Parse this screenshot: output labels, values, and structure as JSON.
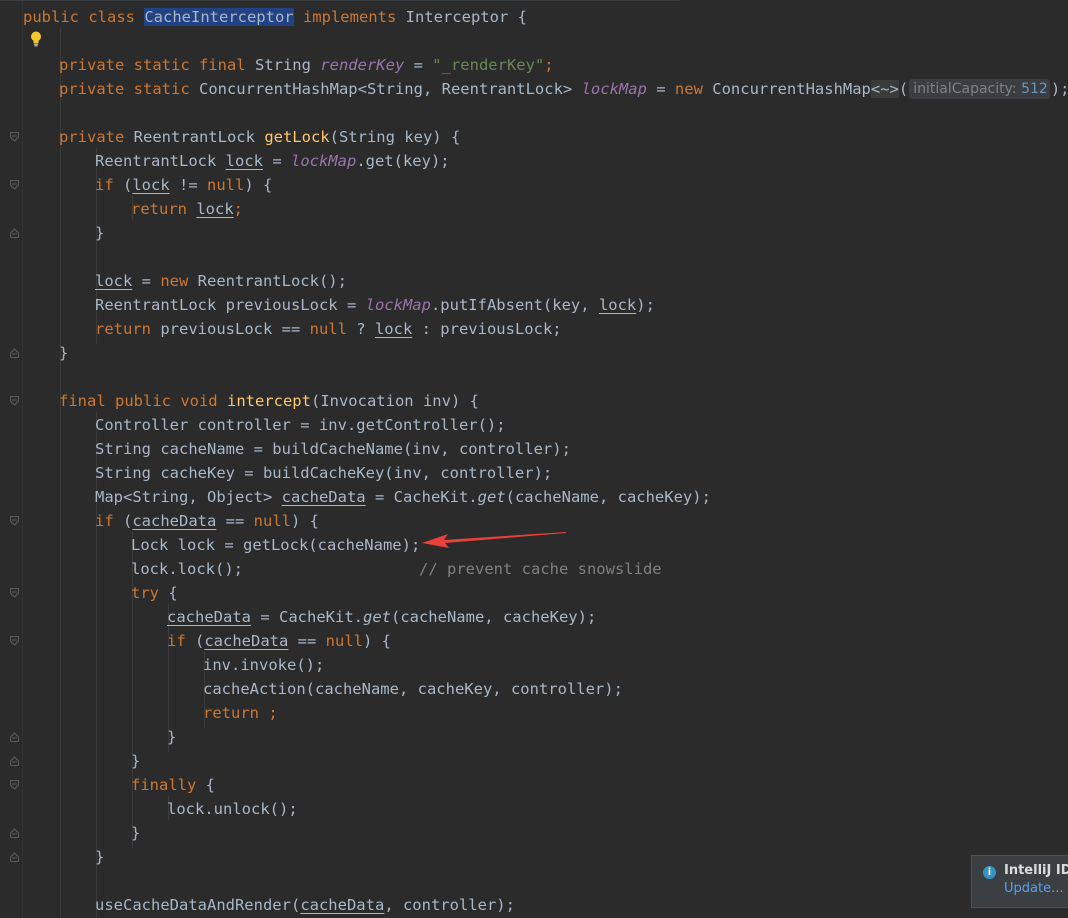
{
  "editor": {
    "language": "java",
    "class_name": "CacheInterceptor",
    "caret_line": 1,
    "highlighted_identifier": "CacheInterceptor",
    "colors": {
      "background": "#2b2b2b",
      "keyword": "#cc7832",
      "method_declaration": "#ffc66d",
      "string": "#6a8759",
      "number": "#6897bb",
      "static_field": "#9876aa",
      "comment": "#808080",
      "default_text": "#a9b7c6"
    },
    "inlay_hint": {
      "name": "initialCapacity:",
      "value": "512"
    },
    "lines": {
      "l1": {
        "kw1": "public class ",
        "cls": "CacheInterceptor",
        "kw2": " implements ",
        "rest": "Interceptor {"
      },
      "l3": {
        "kw": "private static final ",
        "type": "String ",
        "field": "renderKey",
        "eq": " = ",
        "str": "\"_renderKey\"",
        "semi": ";"
      },
      "l4": {
        "kw": "private static ",
        "type": "ConcurrentHashMap<String, ReentrantLock> ",
        "field": "lockMap",
        "eq": " = ",
        "kw2": "new ",
        "ctor": "ConcurrentHashMap",
        "diamond": "<~>",
        "paren_open": "(",
        "paren_close": ");"
      },
      "l6": {
        "kw": "private ",
        "type": "ReentrantLock ",
        "fn": "getLock",
        "rest": "(String key) {"
      },
      "l7": {
        "type": "ReentrantLock ",
        "var": "lock",
        "eq": " = ",
        "field": "lockMap",
        "rest": ".get(key);"
      },
      "l8": {
        "kw": "if ",
        "p1": "(",
        "var": "lock",
        "op": " != ",
        "kw2": "null",
        "rest": ") {"
      },
      "l9": {
        "kw": "return ",
        "var": "lock",
        "semi": ";"
      },
      "l10": {
        "rest": "}"
      },
      "l12": {
        "var": "lock",
        "eq": " = ",
        "kw": "new ",
        "rest": "ReentrantLock();"
      },
      "l13": {
        "type": "ReentrantLock previousLock = ",
        "field": "lockMap",
        "mid": ".putIfAbsent(key, ",
        "var": "lock",
        "rest": ");"
      },
      "l14": {
        "kw": "return ",
        "mid": "previousLock == ",
        "kw2": "null",
        "q": " ? ",
        "var": "lock",
        "rest": " : previousLock;"
      },
      "l15": {
        "rest": "}"
      },
      "l17": {
        "kw": "final public void ",
        "fn": "intercept",
        "rest": "(Invocation inv) {"
      },
      "l18": {
        "rest": "Controller controller = inv.getController();"
      },
      "l19": {
        "rest": "String cacheName = buildCacheName(inv, controller);"
      },
      "l20": {
        "rest": "String cacheKey = buildCacheKey(inv, controller);"
      },
      "l21": {
        "pre": "Map<String, Object> ",
        "var": "cacheData",
        "mid": " = CacheKit.",
        "call": "get",
        "rest": "(cacheName, cacheKey);"
      },
      "l22": {
        "kw": "if ",
        "p1": "(",
        "var": "cacheData",
        "op": " == ",
        "kw2": "null",
        "rest": ") {"
      },
      "l23": {
        "rest": "Lock lock = getLock(cacheName);"
      },
      "l24": {
        "rest": "lock.lock();",
        "cmt": "// prevent cache snowslide"
      },
      "l25": {
        "kw": "try ",
        "rest": "{"
      },
      "l26": {
        "var": "cacheData",
        "mid": " = CacheKit.",
        "call": "get",
        "rest": "(cacheName, cacheKey);"
      },
      "l27": {
        "kw": "if ",
        "p1": "(",
        "var": "cacheData",
        "op": " == ",
        "kw2": "null",
        "rest": ") {"
      },
      "l28": {
        "rest": "inv.invoke();"
      },
      "l29": {
        "rest": "cacheAction(cacheName, cacheKey, controller);"
      },
      "l30": {
        "kw": "return ",
        "semi": ";"
      },
      "l31": {
        "rest": "}"
      },
      "l32": {
        "rest": "}"
      },
      "l33": {
        "kw": "finally ",
        "rest": "{"
      },
      "l34": {
        "rest": "lock.unlock();"
      },
      "l35": {
        "rest": "}"
      },
      "l36": {
        "rest": "}"
      },
      "l38": {
        "pre": "useCacheDataAndRender(",
        "var": "cacheData",
        "rest": ", controller);"
      }
    }
  },
  "annotation": {
    "type": "arrow",
    "color": "#e8413b",
    "points_to": "Lock lock = getLock(cacheName);"
  },
  "notification": {
    "icon": "info-icon",
    "title": "IntelliJ IDE",
    "link": "Update..."
  }
}
